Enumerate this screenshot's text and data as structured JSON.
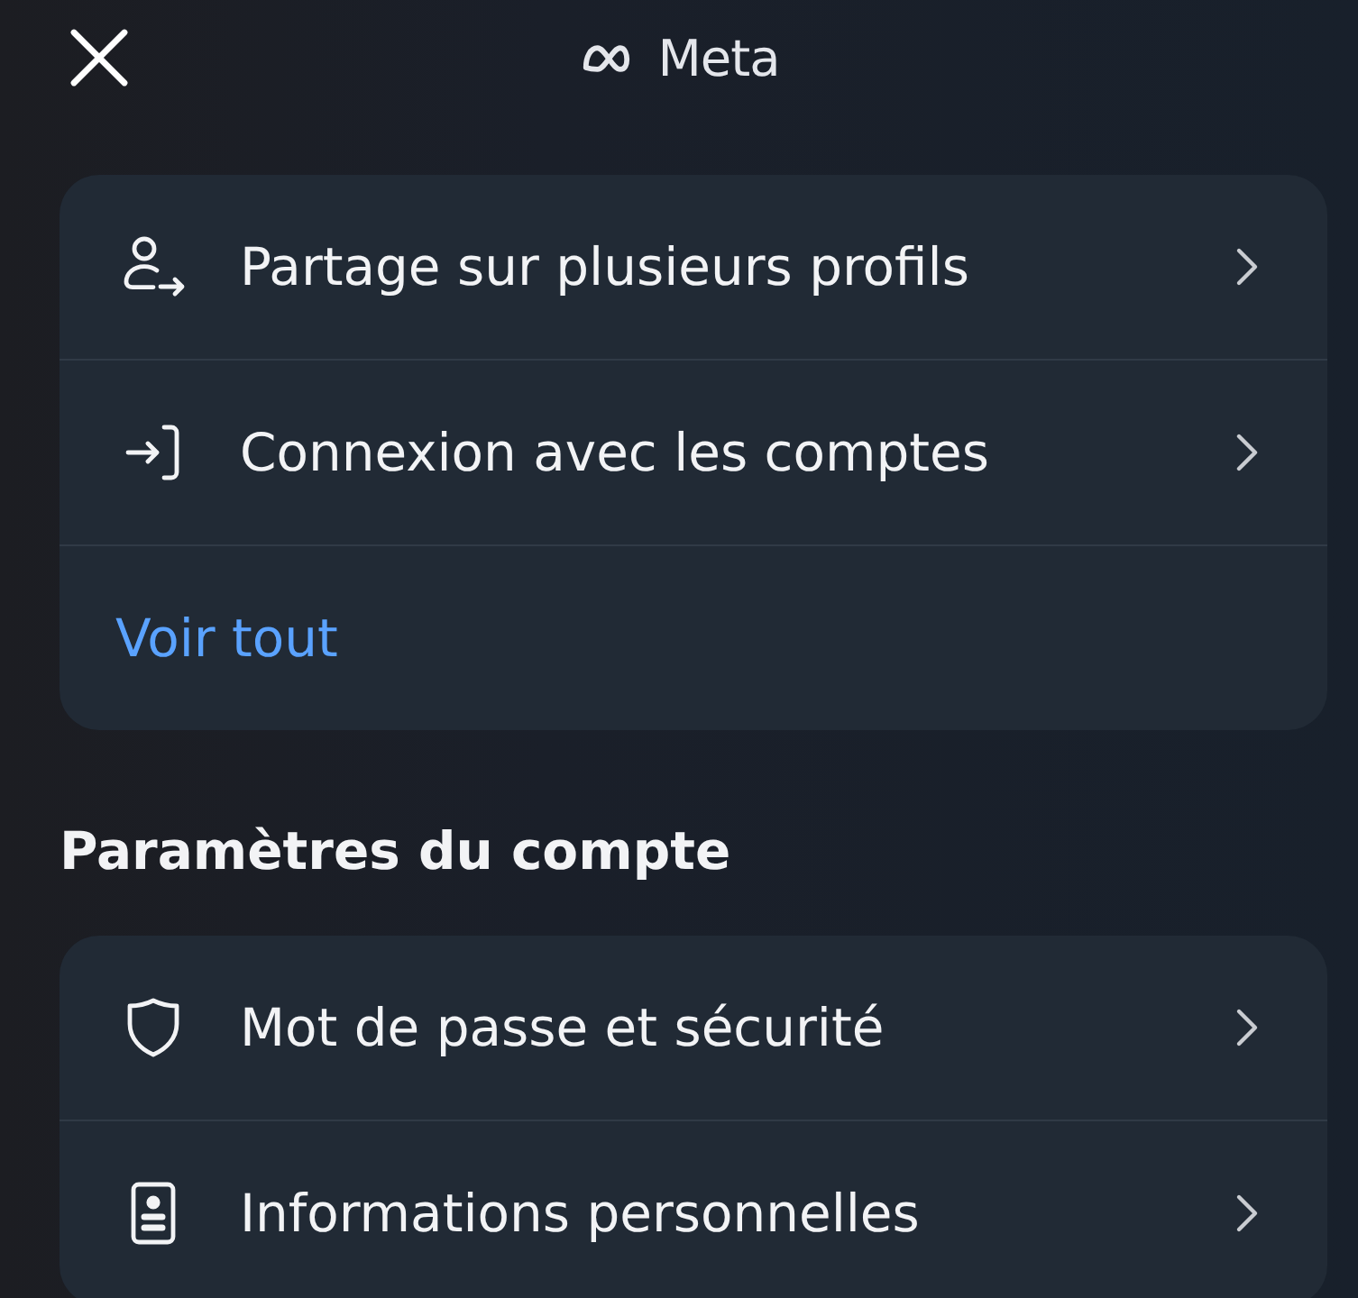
{
  "header": {
    "brand": "Meta"
  },
  "top_card": {
    "items": [
      {
        "kind": "person-arrow",
        "label": "Partage sur plusieurs profils"
      },
      {
        "kind": "enter",
        "label": "Connexion avec les comptes"
      }
    ],
    "link": "Voir tout"
  },
  "account_settings": {
    "title": "Paramètres du compte",
    "items": [
      {
        "kind": "shield",
        "label": "Mot de passe et sécurité"
      },
      {
        "kind": "id-card",
        "label": "Informations personnelles"
      }
    ]
  }
}
